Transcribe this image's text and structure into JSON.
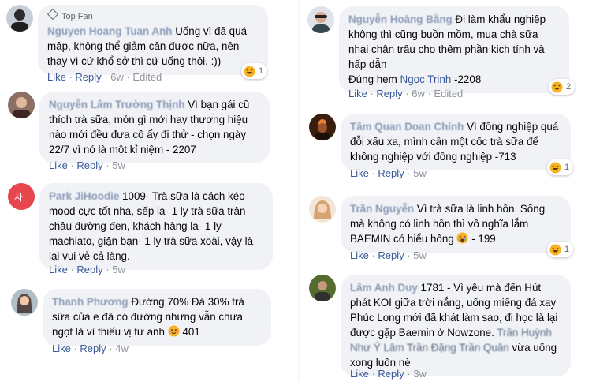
{
  "comments": [
    {
      "badge": "Top Fan",
      "name": "Nguyen Hoang Tuan Anh",
      "text": "Uống vì đã quá mập, không thể giảm cân được nữa, nên thay vì cứ khổ sở thì cứ uống thôi. :))",
      "like": "Like",
      "reply": "Reply",
      "time": "6w",
      "edited": "Edited",
      "reaction_count": "1"
    },
    {
      "name": "Nguyễn Lâm Trường Thịnh",
      "text": "Vì bạn gái cũ thích trà sữa, món gì mới hay thương hiệu nào mới đều đưa cô ấy đi thử - chọn ngày 22/7 vì nó là một kỉ niệm - 2207",
      "like": "Like",
      "reply": "Reply",
      "time": "5w"
    },
    {
      "name": "Park JiHoodie",
      "text": "1009- Trà sữa là cách kéo mood cực tốt nha, sếp la- 1 ly trà sữa trân châu đường đen, khách hàng la- 1 ly machiato, giận bạn- 1 ly trà sữa xoài, vậy là lại vui vẻ cả làng.",
      "like": "Like",
      "reply": "Reply",
      "time": "5w"
    },
    {
      "name": "Thanh Phương",
      "text": "Đường 70% Đá 30% trà sữa của e đã có đường nhưng vẫn chưa ngọt là vì thiếu vị từ anh",
      "text_after": "401",
      "like": "Like",
      "reply": "Reply",
      "time": "4w"
    },
    {
      "name": "Nguyễn Hoàng Bằng",
      "text": "Đi làm khẩu nghiệp không thì cũng buồn mồm, mua chà sữa nhai chân trâu cho thêm phần kịch tính và hấp dẫn",
      "line2_prefix": "Đúng hem",
      "mention": "Ngọc Trinh",
      "line2_suffix": "-2208",
      "like": "Like",
      "reply": "Reply",
      "time": "6w",
      "edited": "Edited",
      "reaction_count": "2"
    },
    {
      "name": "Tâm Quan Doan Chính",
      "text": "Vì đồng nghiệp quá đỗi xấu xa, mình cần một cốc trà sữa để không nghiệp với đồng nghiệp -713",
      "like": "Like",
      "reply": "Reply",
      "time": "5w",
      "reaction_count": "1"
    },
    {
      "name": "Trần Nguyễn",
      "text": "Vì trà sữa là linh hồn. Sống mà không có linh hồn thì vô nghĩa lắm BAEMIN có hiểu hông",
      "text_after": "- 199",
      "like": "Like",
      "reply": "Reply",
      "time": "5w",
      "reaction_count": "1"
    },
    {
      "name": "Lâm Anh Duy",
      "text": "1781 - Vì yêu mà đến Hút phát KOI giữa trời nắng, uống miếng đá xay Phúc Long mới đã khát làm sao, đi học là lại được gặp Baemin ở Nowzone.",
      "blurred_mentions": "Trần Huỳnh Như Ý Lâm Trần Đặng Trần Quân",
      "tail": "vừa uống xong luôn nè",
      "like": "Like",
      "reply": "Reply",
      "time": "3w"
    }
  ],
  "colors": {
    "link": "#385898",
    "bubble": "#f0f2f5",
    "meta": "#90949c"
  }
}
